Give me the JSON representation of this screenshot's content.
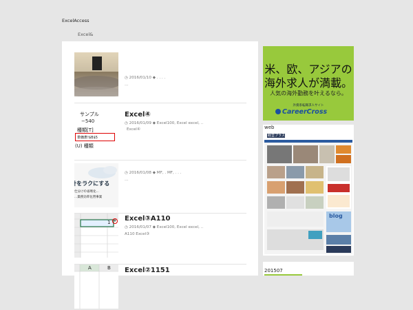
{
  "site": {
    "title": "ExcelAccess",
    "breadcrumb": "Excel&"
  },
  "posts": [
    {
      "title": "",
      "date": "2016/01/10",
      "tags": ". . . .",
      "excerpt": "…"
    },
    {
      "title": "Excel④",
      "date": "2016/01/09",
      "tags": "Excel100, Excel        excel, ..",
      "excerpt": "Excel④",
      "thumb_lines": [
        "サンプル",
        "−540",
        "種類[T]",
        "単価表!$B$5",
        "(U) 種類"
      ]
    },
    {
      "title": "",
      "date": "2016/01/08",
      "tags": "MF, . MF, . . .",
      "excerpt": "…",
      "thumb_lines": [
        "...計をラクにする",
        "仕分けの省略化...",
        "...業務効率化用事業"
      ]
    },
    {
      "title": "Excel③A110",
      "date": "2016/01/07",
      "tags": "Excel100, Excel        excel, ..",
      "excerpt": "A110 Excel③",
      "thumb_cell": "1"
    },
    {
      "title": "Excel②1151",
      "thumb_cols": [
        "A",
        "B"
      ]
    }
  ],
  "sidebar": {
    "ad": {
      "line1": "米、欧、アジアの",
      "line2": "海外求人が満載。",
      "line3": "人気の海外勤務を叶えるなら。",
      "small": "外資系転職求人サイト",
      "brand": "CareerCross",
      "bg": "#98c93c"
    },
    "web_label": "web",
    "web_preview": {
      "logo": "経営プラス",
      "blog": "blog"
    },
    "archive_label": "201507"
  }
}
